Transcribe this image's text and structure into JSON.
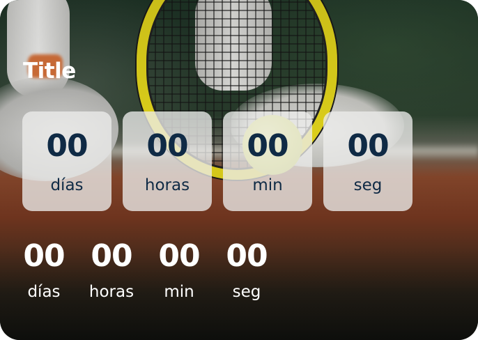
{
  "card": {
    "title": "Title"
  },
  "boxed_countdown": [
    {
      "value": "00",
      "unit": "días"
    },
    {
      "value": "00",
      "unit": "horas"
    },
    {
      "value": "00",
      "unit": "min"
    },
    {
      "value": "00",
      "unit": "seg"
    }
  ],
  "plain_countdown": [
    {
      "value": "00",
      "unit": "días"
    },
    {
      "value": "00",
      "unit": "horas"
    },
    {
      "value": "00",
      "unit": "min"
    },
    {
      "value": "00",
      "unit": "seg"
    }
  ],
  "colors": {
    "box_text": "#0f2a45",
    "light_text": "#ffffff",
    "box_background": "#ececea"
  }
}
